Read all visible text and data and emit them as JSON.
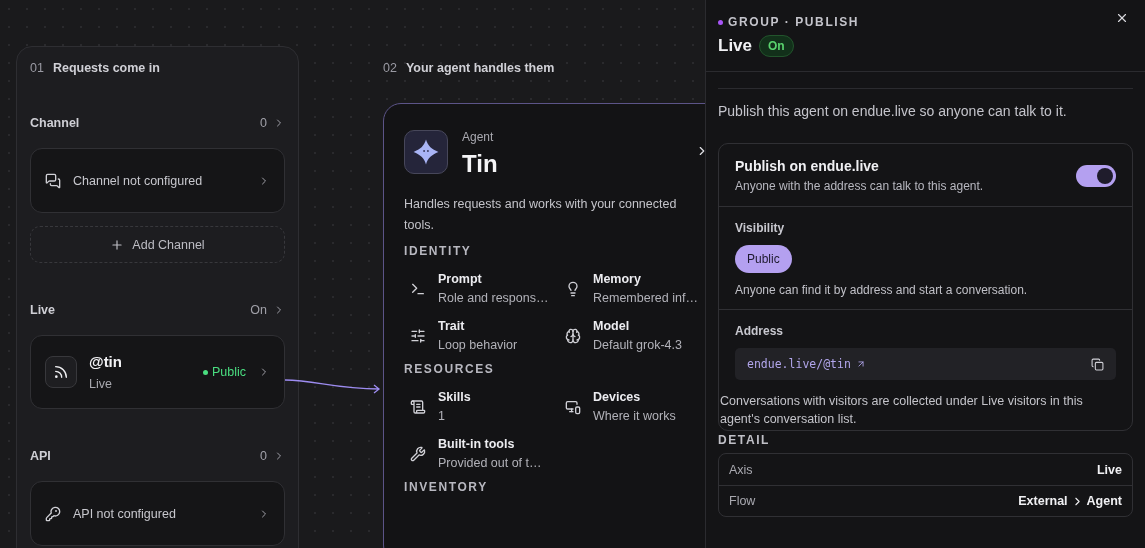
{
  "stages": [
    {
      "number": "01",
      "title": "Requests come in"
    },
    {
      "number": "02",
      "title": "Your agent handles them"
    }
  ],
  "groups": [
    {
      "kind": "channel",
      "label": "Channel",
      "count": "0",
      "card": {
        "kind": "empty",
        "text": "Channel not configured"
      },
      "add_label": "Add Channel"
    },
    {
      "kind": "live",
      "label": "Live",
      "count": "On",
      "card": {
        "kind": "live",
        "handle": "@tin",
        "subtitle": "Live",
        "status": "Public",
        "color": "#4ade80"
      }
    },
    {
      "kind": "api",
      "label": "API",
      "count": "0",
      "card": {
        "kind": "empty",
        "text": "API not configured"
      }
    }
  ],
  "agent": {
    "label": "Agent",
    "name": "Tin",
    "description": "Handles requests and works with your connected tools.",
    "sections": [
      {
        "title": "IDENTITY",
        "items": [
          {
            "kind": "prompt",
            "title": "Prompt",
            "subtitle": "Role and respons…"
          },
          {
            "kind": "memory",
            "title": "Memory",
            "subtitle": "Remembered inf…"
          },
          {
            "kind": "trait",
            "title": "Trait",
            "subtitle": "Loop behavior"
          },
          {
            "kind": "model",
            "title": "Model",
            "subtitle": "Default grok-4.3"
          }
        ]
      },
      {
        "title": "RESOURCES",
        "items": [
          {
            "kind": "skills",
            "title": "Skills",
            "subtitle": "1"
          },
          {
            "kind": "devices",
            "title": "Devices",
            "subtitle": "Where it works"
          },
          {
            "kind": "tools",
            "title": "Built-in tools",
            "subtitle": "Provided out of t…"
          }
        ]
      },
      {
        "title": "INVENTORY"
      }
    ]
  },
  "panel": {
    "eyebrow": "GROUP · PUBLISH",
    "title": "Live",
    "status": {
      "label": "On",
      "on": true
    },
    "intro": "Publish this agent on endue.live so anyone can talk to it.",
    "publish": {
      "title": "Publish on endue.live",
      "description": "Anyone with the address can talk to this agent.",
      "on": true
    },
    "visibility": {
      "label": "Visibility",
      "options": [
        {
          "label": "Public",
          "selected": true
        }
      ],
      "hint": "Anyone can find it by address and start a conversation."
    },
    "address": {
      "label": "Address",
      "value": "endue.live/@tin"
    },
    "note": "Conversations with visitors are collected under Live visitors in this agent's conversation list.",
    "detail": {
      "heading": "DETAIL",
      "rows": [
        {
          "label": "Axis",
          "values": [
            "Live"
          ]
        },
        {
          "label": "Flow",
          "values": [
            "External",
            "Agent"
          ]
        }
      ]
    }
  }
}
